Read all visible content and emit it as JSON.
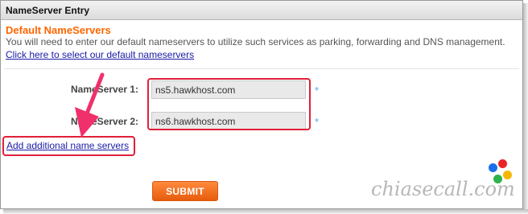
{
  "window": {
    "title": "NameServer Entry"
  },
  "defaults": {
    "title": "Default NameServers",
    "description": "You will need to enter our default nameservers to utilize such services as parking, forwarding and DNS management.",
    "select_link": "Click here to select our default nameservers"
  },
  "nameservers": [
    {
      "label": "NameServer 1:",
      "value": "ns5.hawkhost.com",
      "required_mark": "*"
    },
    {
      "label": "NameServer 2:",
      "value": "ns6.hawkhost.com",
      "required_mark": "*"
    }
  ],
  "add_link": "Add additional name servers",
  "submit_label": "SUBMIT",
  "watermark": {
    "text": "chiasecall.com",
    "dot_colors": [
      "#1a6fe8",
      "#e8232a",
      "#f5b800",
      "#2db34a"
    ]
  },
  "colors": {
    "accent": "#ff6600",
    "highlight": "#e0203a",
    "arrow": "#f0306a",
    "link": "#1a1aa6",
    "required": "#5aa5f0"
  }
}
